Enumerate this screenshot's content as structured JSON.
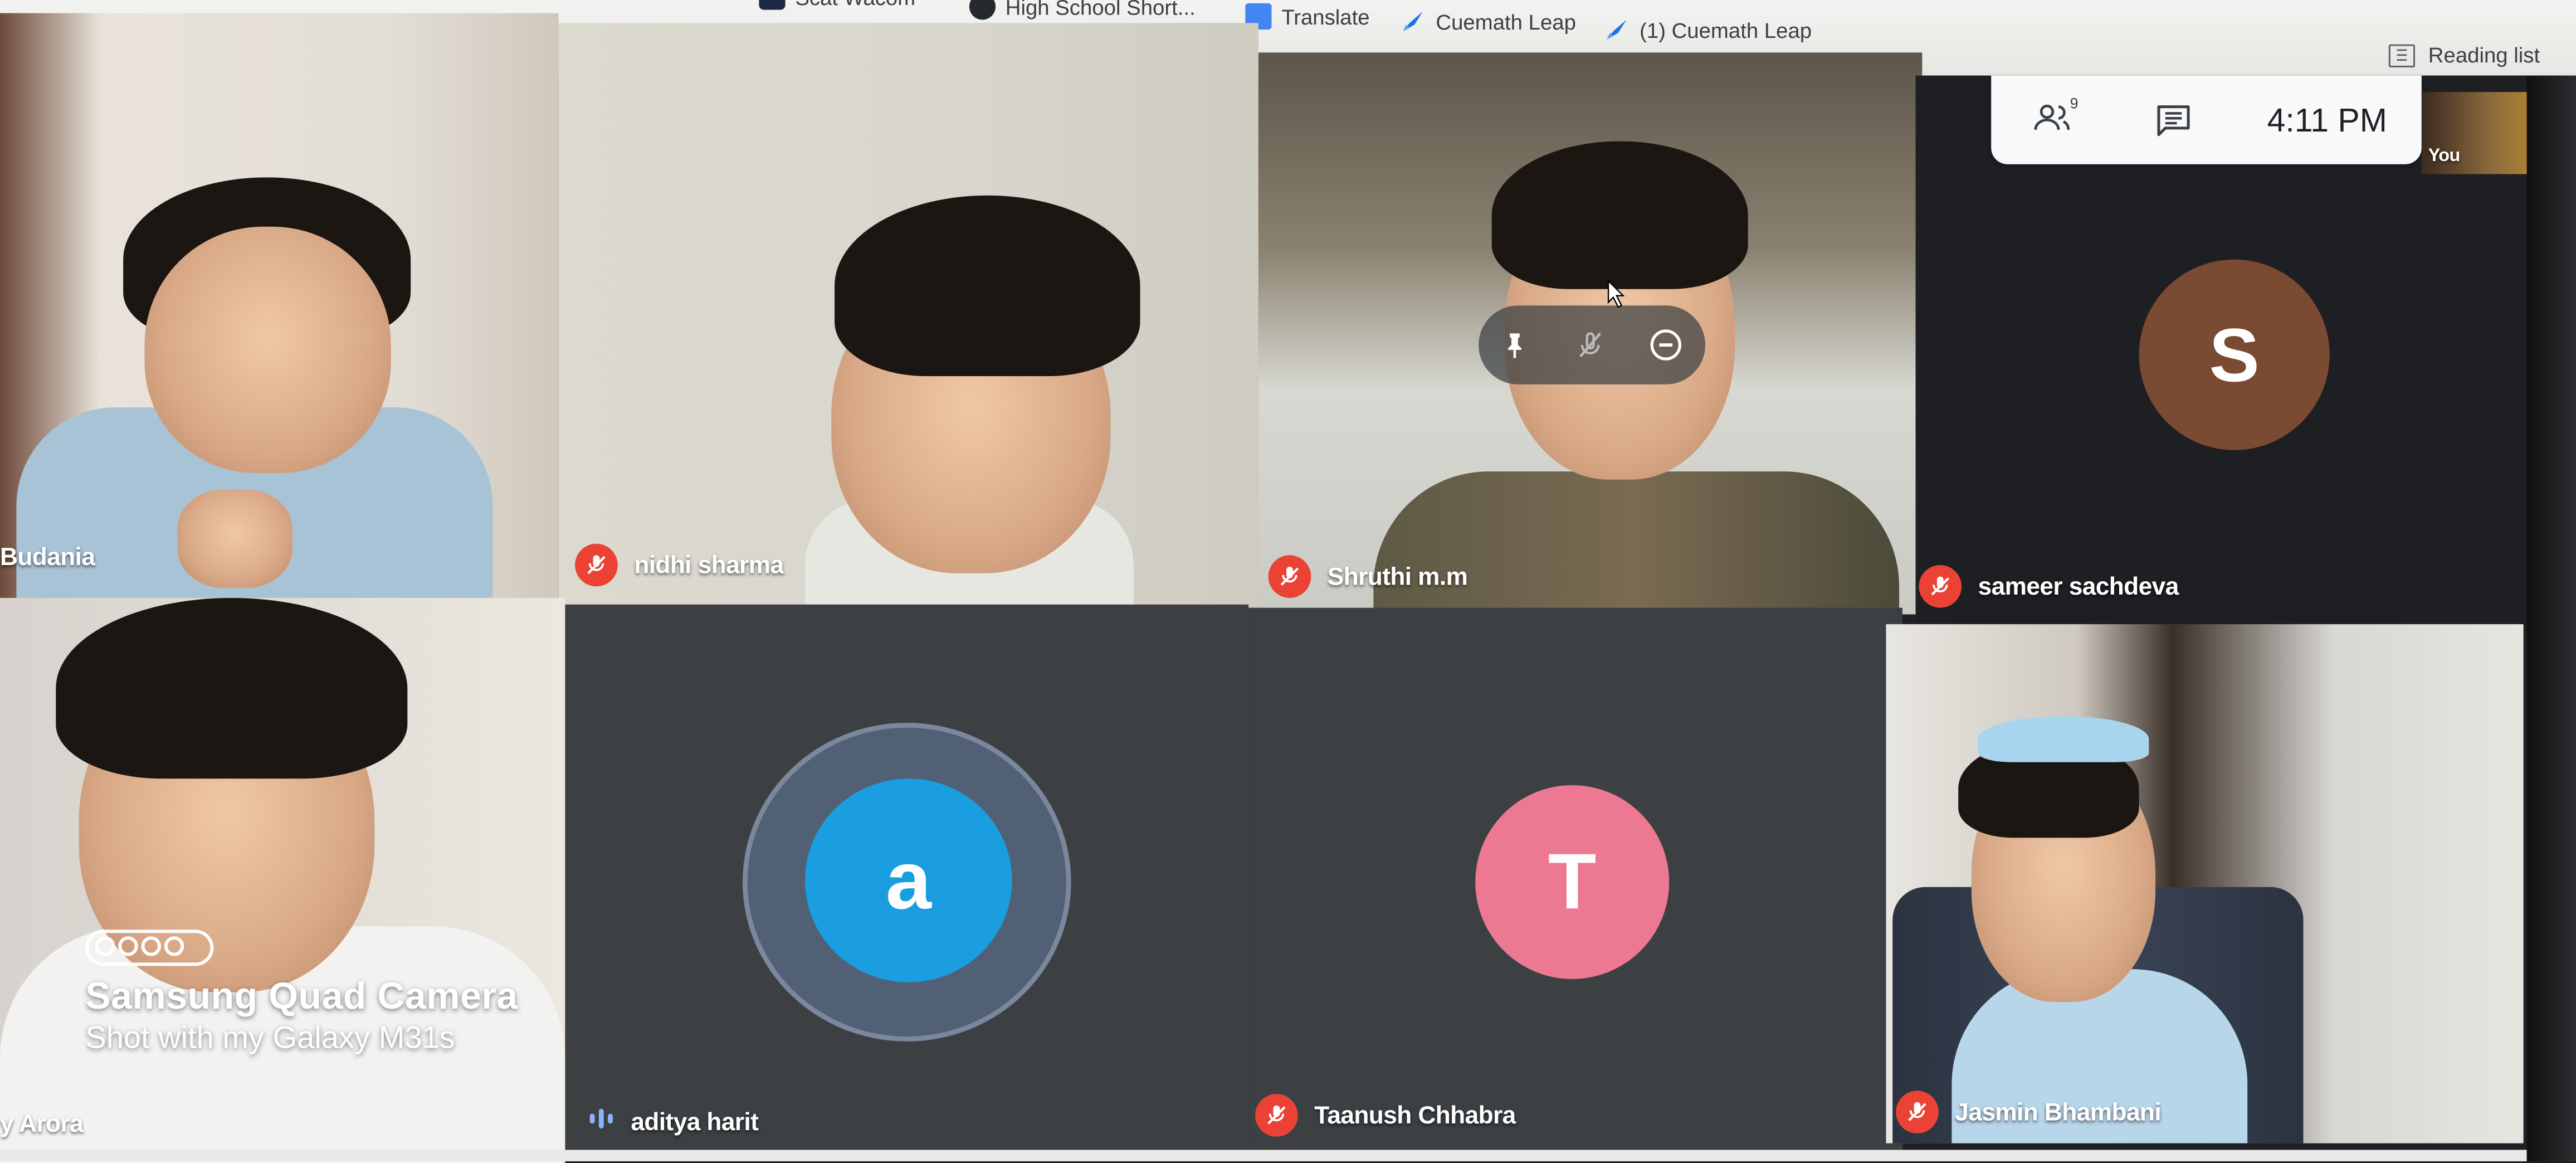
{
  "bookmarks_bar": {
    "items": [
      {
        "label": "Scat Wacom",
        "icon": "scat-wacom-icon"
      },
      {
        "label": "High School Short...",
        "icon": "github-icon"
      },
      {
        "label": "Translate",
        "icon": "google-translate-icon"
      },
      {
        "label": "Cuemath Leap",
        "icon": "rocket-icon"
      },
      {
        "label": "(1) Cuemath Leap",
        "icon": "rocket-icon"
      }
    ],
    "reading_list_label": "Reading list"
  },
  "meeting_info": {
    "participants_count": "9",
    "time": "4:11 PM"
  },
  "self_view": {
    "label": "You"
  },
  "participants": [
    {
      "name": "Budania",
      "muted": false,
      "avatar": null
    },
    {
      "name": "nidhi sharma",
      "muted": true,
      "avatar": null
    },
    {
      "name": "Shruthi m.m",
      "muted": true,
      "avatar": null
    },
    {
      "name": "sameer sachdeva",
      "muted": true,
      "avatar": {
        "letter": "S",
        "color": "#7b4a32"
      }
    },
    {
      "name": "y Arora",
      "muted": false,
      "avatar": null
    },
    {
      "name": "aditya harit",
      "muted": false,
      "speaking": true,
      "avatar": {
        "letter": "a",
        "color": "#1a9ee0"
      }
    },
    {
      "name": "Taanush Chhabra",
      "muted": true,
      "avatar": {
        "letter": "T",
        "color": "#ec7891"
      }
    },
    {
      "name": "Jasmin Bhambani",
      "muted": true,
      "avatar": null
    }
  ],
  "hover_controls": [
    "pin-icon",
    "mic-off-icon",
    "remove-icon"
  ],
  "watermark": {
    "title": "Samsung Quad Camera",
    "subtitle": "Shot with my Galaxy M31s"
  },
  "colors": {
    "mic_off": "#ea4335",
    "panel_bg": "#f8f9fa",
    "speaking": "#8ab4f8"
  }
}
